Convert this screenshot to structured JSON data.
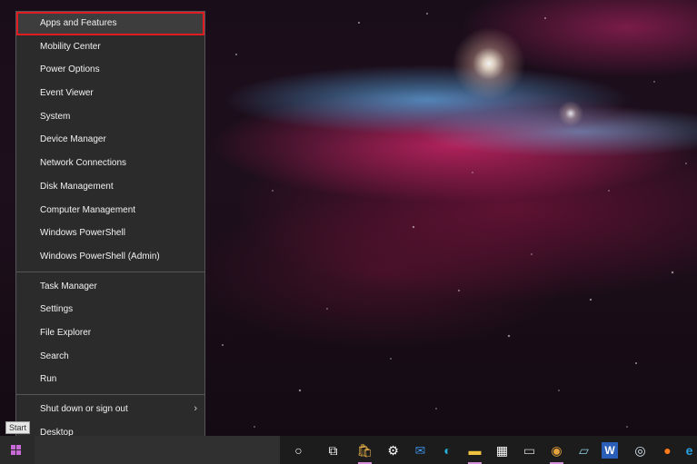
{
  "menu": {
    "items": [
      {
        "label": "Apps and Features",
        "highlighted": true
      },
      {
        "label": "Mobility Center"
      },
      {
        "label": "Power Options"
      },
      {
        "label": "Event Viewer"
      },
      {
        "label": "System"
      },
      {
        "label": "Device Manager"
      },
      {
        "label": "Network Connections"
      },
      {
        "label": "Disk Management"
      },
      {
        "label": "Computer Management"
      },
      {
        "label": "Windows PowerShell"
      },
      {
        "label": "Windows PowerShell (Admin)"
      },
      {
        "label": "Task Manager"
      },
      {
        "label": "Settings"
      },
      {
        "label": "File Explorer"
      },
      {
        "label": "Search"
      },
      {
        "label": "Run"
      },
      {
        "label": "Shut down or sign out",
        "has_submenu": true
      },
      {
        "label": "Desktop"
      }
    ],
    "submenu_arrow": "›",
    "highlight_color": "#e01b22"
  },
  "tooltip": {
    "start": "Start"
  },
  "taskbar": {
    "icons": [
      {
        "name": "cortana-icon",
        "glyph": "○"
      },
      {
        "name": "task-view-icon",
        "glyph": "⧉"
      },
      {
        "name": "microsoft-store-icon",
        "glyph": "🛍",
        "active": true
      },
      {
        "name": "settings-gear-icon",
        "glyph": "⚙"
      },
      {
        "name": "mail-icon",
        "glyph": "✉"
      },
      {
        "name": "edge-icon",
        "glyph": "◐"
      },
      {
        "name": "file-explorer-icon",
        "glyph": "▬",
        "active": true
      },
      {
        "name": "calculator-icon",
        "glyph": "▦"
      },
      {
        "name": "photos-icon",
        "glyph": "▭"
      },
      {
        "name": "chrome-icon",
        "glyph": "◉",
        "active": true
      },
      {
        "name": "notepad-icon",
        "glyph": "▱"
      },
      {
        "name": "word-icon",
        "glyph": "W"
      },
      {
        "name": "steam-icon",
        "glyph": "◎"
      },
      {
        "name": "firefox-icon",
        "glyph": "●"
      },
      {
        "name": "browser-e-icon",
        "glyph": "e"
      }
    ],
    "accent": "#d38fd8"
  }
}
